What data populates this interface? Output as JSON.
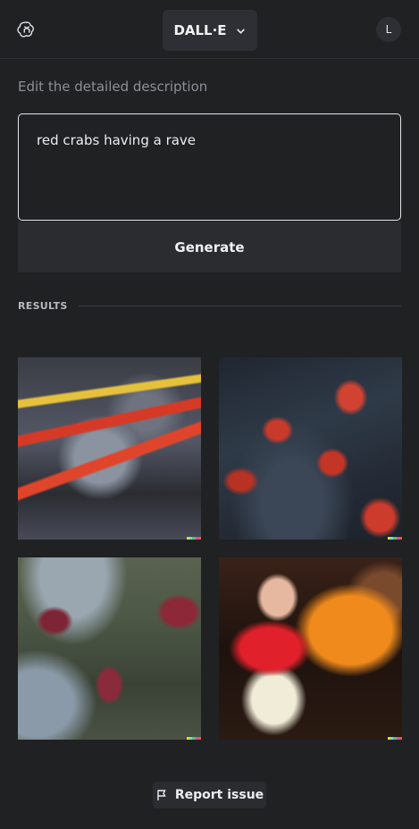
{
  "header": {
    "model_label": "DALL·E",
    "avatar_initial": "L"
  },
  "editor": {
    "section_label": "Edit the detailed description",
    "prompt_text": "red crabs having a rave",
    "generate_label": "Generate"
  },
  "results": {
    "header_label": "RESULTS",
    "images": [
      {
        "icon": "crab-image"
      },
      {
        "icon": "crab-image"
      },
      {
        "icon": "crab-image"
      },
      {
        "icon": "party-image"
      }
    ],
    "signature_colors": [
      "#f5d90a",
      "#6fd7e6",
      "#52c95a",
      "#e63ed4",
      "#f5543b"
    ]
  },
  "footer": {
    "report_label": "Report issue"
  }
}
